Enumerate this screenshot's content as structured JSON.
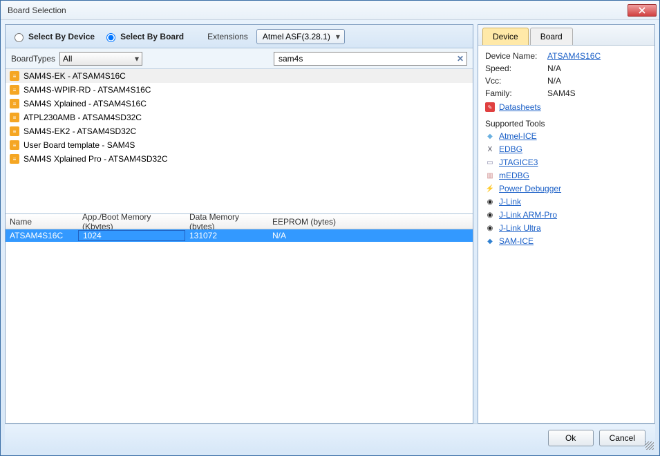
{
  "window": {
    "title": "Board Selection"
  },
  "top": {
    "select_by_device": "Select By Device",
    "select_by_board": "Select By Board",
    "extensions_label": "Extensions",
    "extensions_value": "Atmel ASF(3.28.1)"
  },
  "filter": {
    "board_types_label": "BoardTypes",
    "board_types_value": "All",
    "search_value": "sam4s"
  },
  "boards": [
    {
      "label": "SAM4S-EK - ATSAM4S16C",
      "selected": true
    },
    {
      "label": "SAM4S-WPIR-RD - ATSAM4S16C",
      "selected": false
    },
    {
      "label": "SAM4S Xplained - ATSAM4S16C",
      "selected": false
    },
    {
      "label": "ATPL230AMB - ATSAM4SD32C",
      "selected": false
    },
    {
      "label": "SAM4S-EK2 - ATSAM4SD32C",
      "selected": false
    },
    {
      "label": "User Board template - SAM4S",
      "selected": false
    },
    {
      "label": "SAM4S Xplained Pro - ATSAM4SD32C",
      "selected": false
    }
  ],
  "device_table": {
    "headers": {
      "name": "Name",
      "app": "App./Boot Memory (Kbytes)",
      "data": "Data Memory (bytes)",
      "eeprom": "EEPROM (bytes)"
    },
    "rows": [
      {
        "name": "ATSAM4S16C",
        "app": "1024",
        "data": "131072",
        "eeprom": "N/A",
        "selected": true
      }
    ]
  },
  "side": {
    "tabs": {
      "device": "Device",
      "board": "Board"
    },
    "device_name_label": "Device Name:",
    "device_name_value": "ATSAM4S16C",
    "speed_label": "Speed:",
    "speed_value": "N/A",
    "vcc_label": "Vcc:",
    "vcc_value": "N/A",
    "family_label": "Family:",
    "family_value": "SAM4S",
    "datasheets_label": "Datasheets",
    "supported_tools_label": "Supported Tools",
    "tools": [
      {
        "label": "Atmel-ICE",
        "icon": "◆",
        "color": "#6ab0e0"
      },
      {
        "label": "EDBG",
        "icon": "X",
        "color": "#445"
      },
      {
        "label": "JTAGICE3",
        "icon": "▭",
        "color": "#88a"
      },
      {
        "label": "mEDBG",
        "icon": "▥",
        "color": "#c88"
      },
      {
        "label": "Power Debugger",
        "icon": "⚡",
        "color": "#c05050"
      },
      {
        "label": "J-Link",
        "icon": "◉",
        "color": "#222"
      },
      {
        "label": "J-Link ARM-Pro",
        "icon": "◉",
        "color": "#222"
      },
      {
        "label": "J-Link Ultra",
        "icon": "◉",
        "color": "#222"
      },
      {
        "label": "SAM-ICE",
        "icon": "◆",
        "color": "#3080d0"
      }
    ]
  },
  "buttons": {
    "ok": "Ok",
    "cancel": "Cancel"
  }
}
